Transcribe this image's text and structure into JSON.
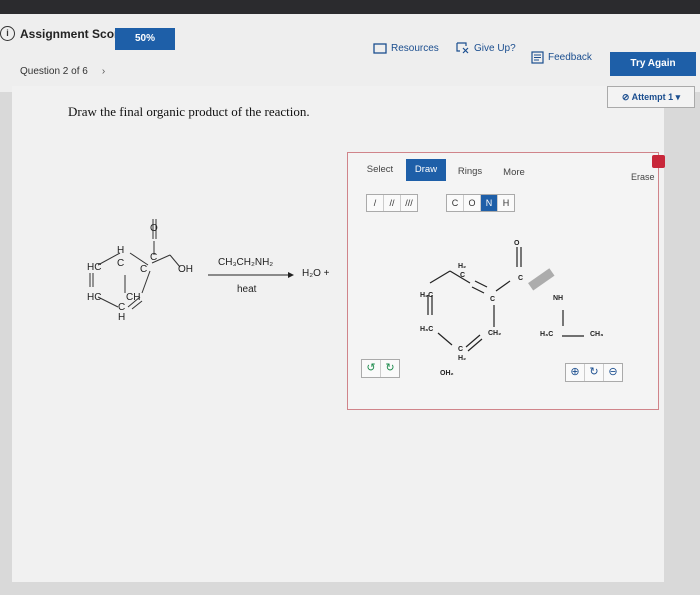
{
  "header": {
    "score_label": "Assignment Score:",
    "score_value": "50%",
    "resources": "Resources",
    "give_up": "Give Up?",
    "feedback": "Feedback",
    "try_again": "Try Again",
    "question_nav": "Question 2 of 6",
    "attempt": "Attempt 1"
  },
  "question": {
    "prompt": "Draw the final organic product of the reaction.",
    "reagent": "CH₃CH₂NH₂",
    "condition": "heat",
    "byproduct": "H₂O  +"
  },
  "reactant_labels": {
    "hc1": "HC",
    "hc2": "HC",
    "ch": "CH",
    "oh": "OH",
    "o": "O",
    "c_top": "C",
    "c_mid": "C",
    "c_bot": "C",
    "h_top": "H",
    "h_bot": "H",
    "c_right": "C"
  },
  "editor": {
    "tabs": [
      "Select",
      "Draw",
      "Rings",
      "More"
    ],
    "erase": "Erase",
    "bond_tools": [
      "/",
      "//",
      "///"
    ],
    "atoms": [
      "C",
      "O",
      "N",
      "H"
    ],
    "atoms_selected": "N"
  },
  "drawn_labels": {
    "o": "O",
    "c1": "C",
    "h2c": "H₂C",
    "h3c": "H₃C",
    "h2": "H₂",
    "c_top": "C",
    "c_right": "C",
    "ch2": "CH₂",
    "c_bottom": "C",
    "h2b": "H₂",
    "oh2": "OH₂",
    "nh": "NH",
    "h3c2": "H₃C",
    "ch3": "CH₃"
  }
}
